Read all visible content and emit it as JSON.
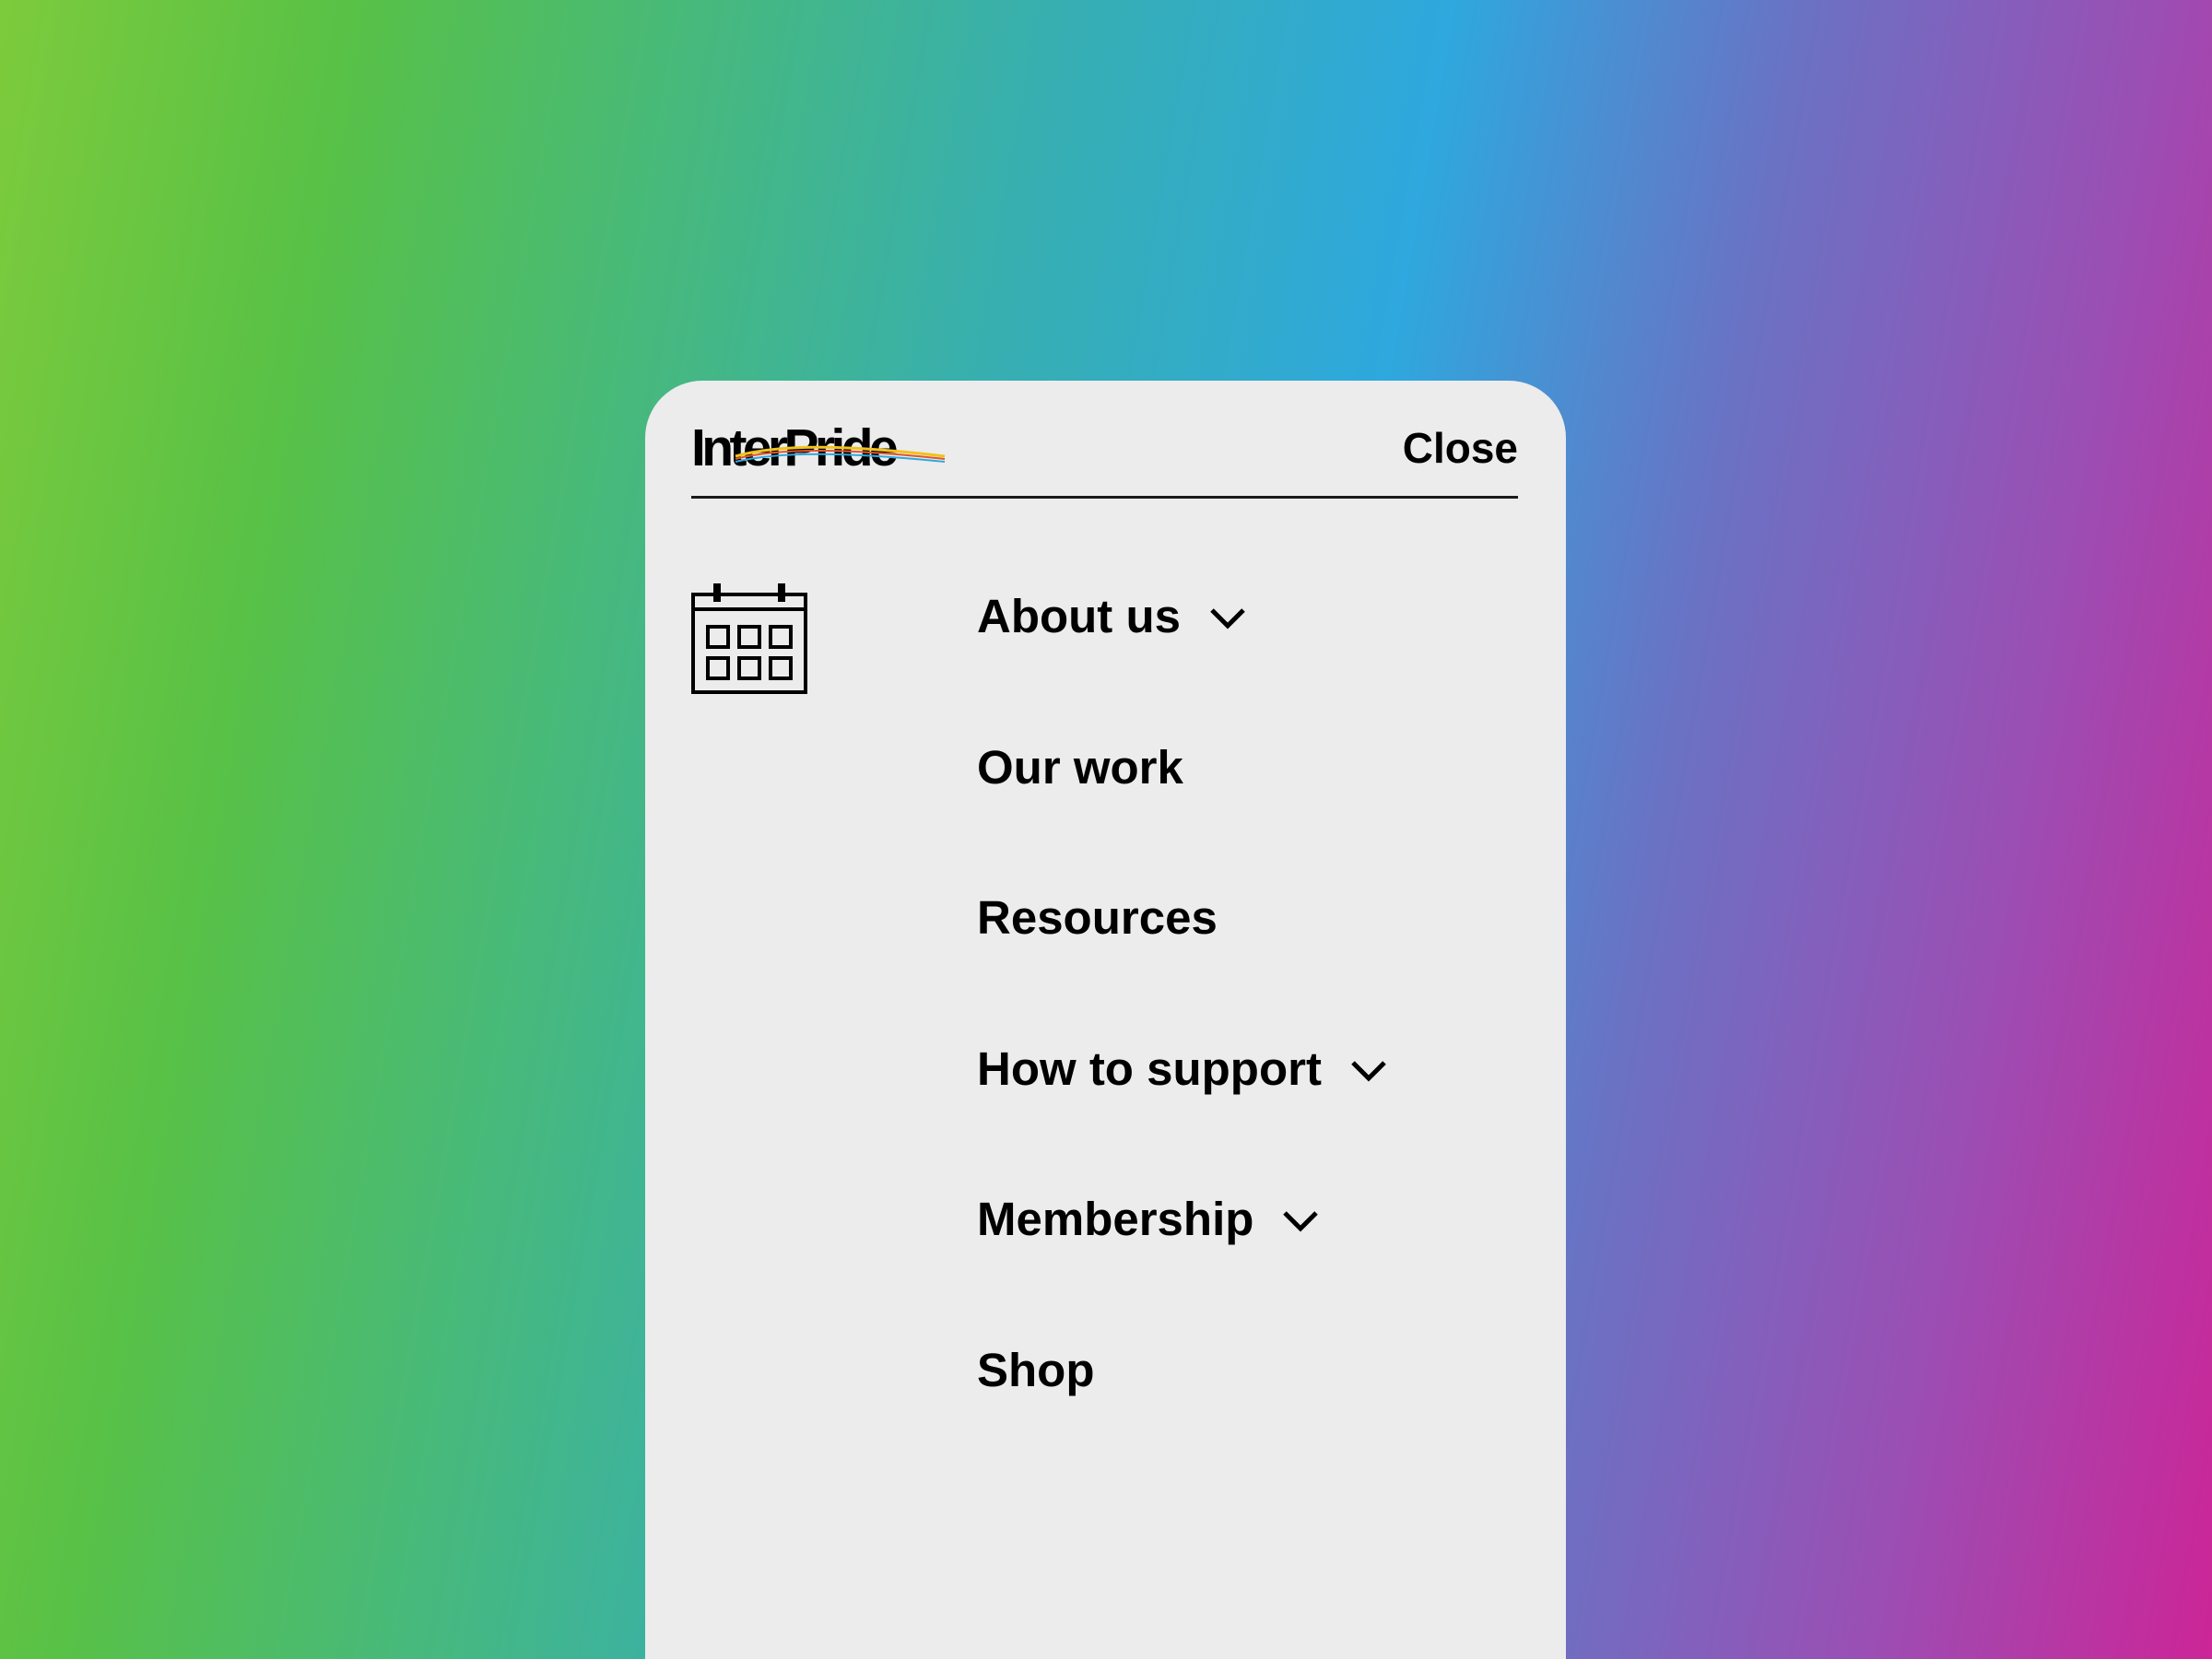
{
  "header": {
    "logo_text": "InterPride",
    "close_label": "Close"
  },
  "icons": {
    "calendar": "calendar-icon",
    "chevron": "chevron-down-icon"
  },
  "menu": {
    "items": [
      {
        "label": "About us",
        "has_dropdown": true
      },
      {
        "label": "Our work",
        "has_dropdown": false
      },
      {
        "label": "Resources",
        "has_dropdown": false
      },
      {
        "label": "How to support",
        "has_dropdown": true
      },
      {
        "label": "Membership",
        "has_dropdown": true
      },
      {
        "label": "Shop",
        "has_dropdown": false
      }
    ]
  },
  "colors": {
    "panel_bg": "#ececec",
    "text": "#000000",
    "gradient": [
      "#7dcb3c",
      "#58c146",
      "#37afb0",
      "#2ea8de",
      "#9a4fb4",
      "#cc2597"
    ]
  }
}
